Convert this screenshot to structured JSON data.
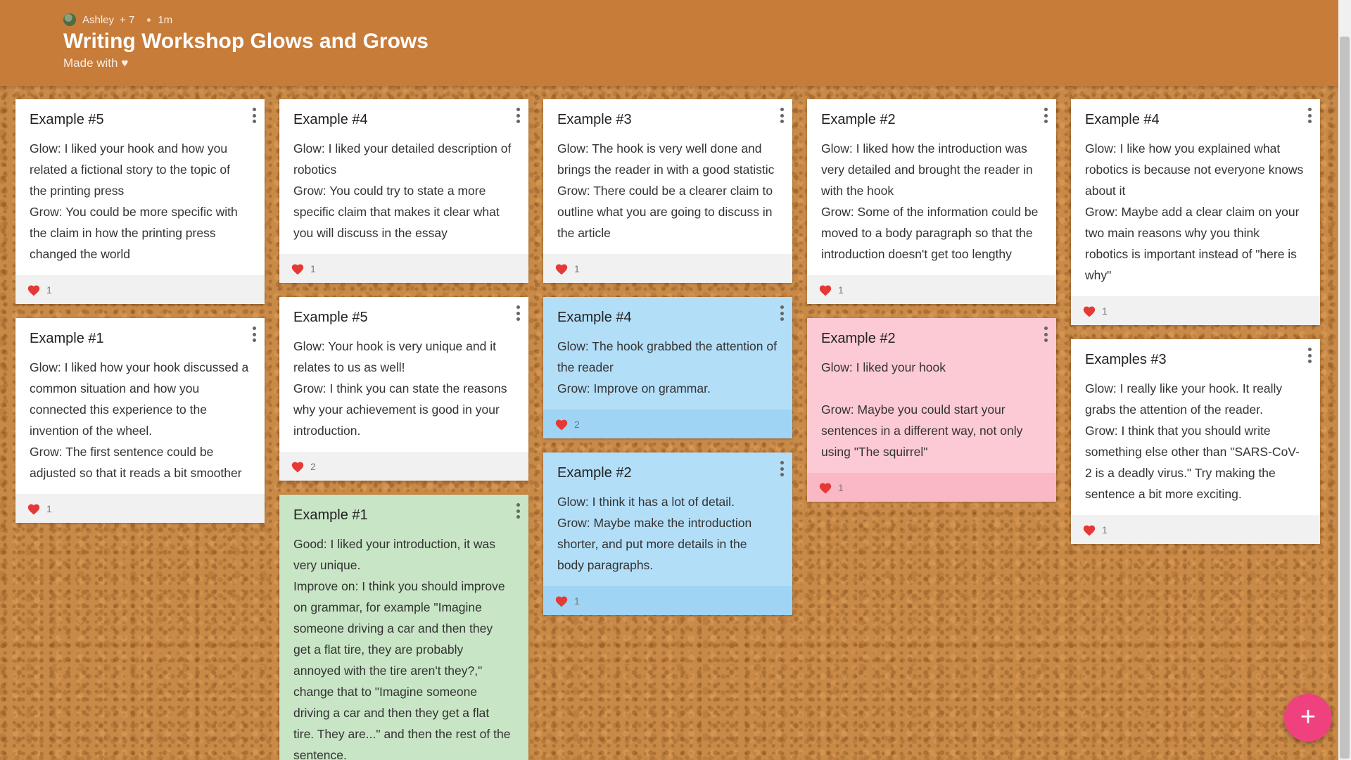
{
  "header": {
    "author": "Ashley",
    "contributors": "+ 7",
    "time_ago": "1m",
    "title": "Writing Workshop Glows and Grows",
    "subtitle": "Made with ♥"
  },
  "columns": [
    [
      {
        "title": "Example #5",
        "text": "Glow: I liked your hook and how you related a fictional story to the topic of the printing press\nGrow: You could be more specific with the claim in how the printing press changed the world",
        "likes": "1",
        "color": "#ffffff"
      },
      {
        "title": "Example #1",
        "text": "Glow: I liked how your hook discussed a common situation and how you connected this experience to the invention of the wheel.\nGrow: The first sentence could be adjusted so that it reads a bit smoother",
        "likes": "1",
        "color": "#ffffff"
      }
    ],
    [
      {
        "title": "Example #4",
        "text": "Glow: I liked your detailed description of robotics\nGrow: You could try to state a more specific claim that makes it clear what you will discuss in the essay",
        "likes": "1",
        "color": "#ffffff"
      },
      {
        "title": "Example #5",
        "text": "Glow: Your hook is very unique and it relates to us as well!\nGrow: I think you can state the reasons why your achievement is good in your introduction.",
        "likes": "2",
        "color": "#ffffff"
      },
      {
        "title": "Example #1",
        "text": "Good: I liked your introduction, it was very unique.\nImprove on: I think you should improve on grammar, for example \"Imagine someone driving a car and then they get a flat tire, they are probably annoyed with the tire aren't they?,\" change that to \"Imagine someone driving a car and then they get a flat tire. They are...\" and then the rest of the sentence.",
        "likes": "",
        "color": "#c8e5c5"
      }
    ],
    [
      {
        "title": "Example #3",
        "text": "Glow: The hook is very well done and brings the reader in with a good statistic\nGrow: There could be a clearer claim to outline what you are going to discuss in the article",
        "likes": "1",
        "color": "#ffffff"
      },
      {
        "title": "Example #4",
        "text": "Glow: The hook grabbed the attention of the reader\nGrow: Improve on grammar.",
        "likes": "2",
        "color": "#b3def8"
      },
      {
        "title": "Example #2",
        "text": "Glow: I think it has a lot of detail.\nGrow: Maybe make the introduction shorter, and put more details in the body paragraphs.",
        "likes": "1",
        "color": "#b3def8"
      }
    ],
    [
      {
        "title": "Example #2",
        "text": "Glow: I liked how the introduction was very detailed and brought the reader in with the hook\nGrow: Some of the information could be moved to a body paragraph so that the introduction doesn't get too lengthy",
        "likes": "1",
        "color": "#ffffff"
      },
      {
        "title": "Example #2",
        "text": "Glow: I liked your hook\n\nGrow: Maybe you could start your sentences in  a different way, not only using \"The squirrel\"",
        "likes": "1",
        "color": "#fccad4"
      }
    ],
    [
      {
        "title": "Example #4",
        "text": "Glow: I like how you explained what robotics is because not everyone knows about it\nGrow: Maybe add a clear claim on your two main reasons why you think robotics is important instead of \"here is why\"",
        "likes": "1",
        "color": "#ffffff"
      },
      {
        "title": "Examples #3",
        "text": "Glow: I really like your hook. It really grabs the attention of the reader.\nGrow: I think that you should write something else other than \"SARS-CoV-2 is a deadly virus.\" Try making the sentence a bit more exciting.",
        "likes": "1",
        "color": "#ffffff"
      }
    ]
  ],
  "icons": {
    "like": "heart-icon",
    "menu": "more-vert-icon",
    "add": "plus-icon"
  },
  "fab": {
    "label": "+"
  },
  "colors": {
    "header": "#c77c3a",
    "heart": "#e53935",
    "fab": "#f0417f",
    "note_blue": "#b3def8",
    "note_pink": "#fccad4",
    "note_green": "#c8e5c5"
  }
}
